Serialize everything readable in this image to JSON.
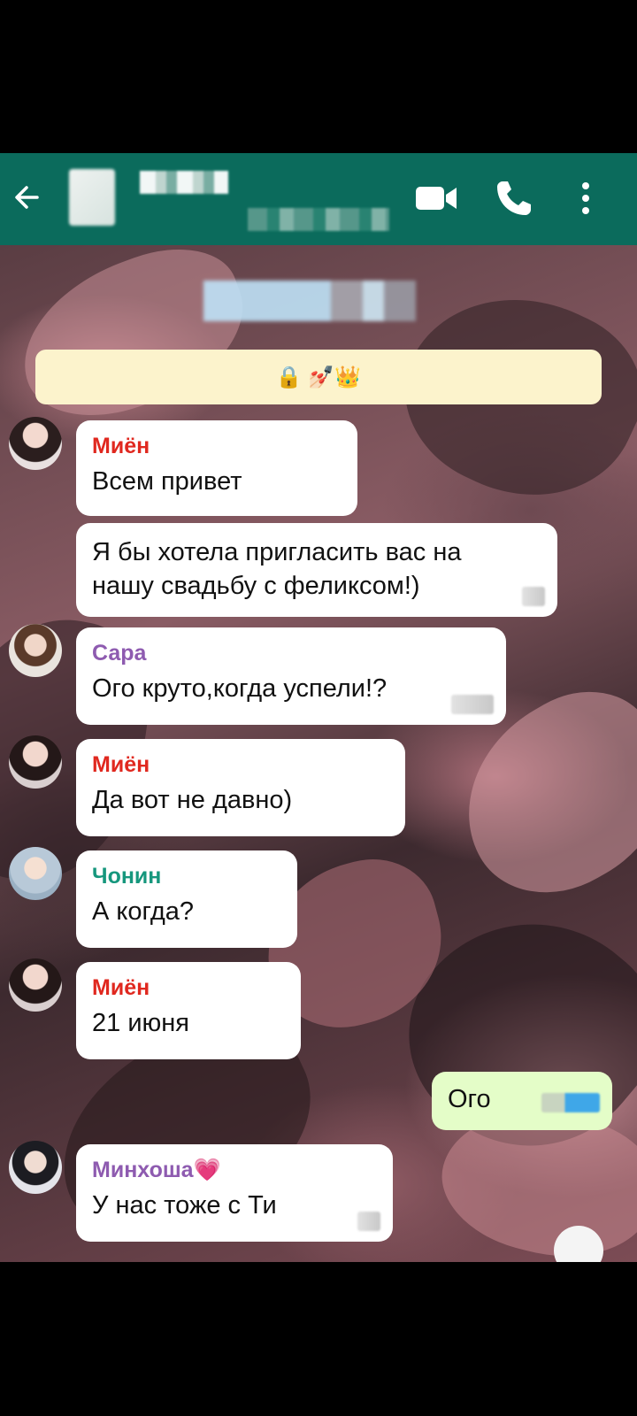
{
  "header": {
    "back_icon": "arrow-left-icon",
    "video_icon": "video-camera-icon",
    "call_icon": "phone-icon",
    "menu_icon": "more-vertical-icon",
    "bg_color": "#0b6b5c"
  },
  "system_message": {
    "text": "🔒 💅🏻👑"
  },
  "messages": [
    {
      "sender": "Миён",
      "sender_color": "#e0281f",
      "text": "Всем привет"
    },
    {
      "sender": "",
      "text": "Я бы хотела пригласить вас на\nнашу свадьбу с феликсом!)"
    },
    {
      "sender": "Сара",
      "sender_color": "#8e5bb0",
      "text": "Ого круто,когда успели!?"
    },
    {
      "sender": "Миён",
      "sender_color": "#e0281f",
      "text": "Да вот не давно)"
    },
    {
      "sender": "Чонин",
      "sender_color": "#16977d",
      "text": "А когда?"
    },
    {
      "sender": "Миён",
      "sender_color": "#e0281f",
      "text": "21 июня"
    },
    {
      "sender": "",
      "text": "Ого",
      "outgoing": true
    },
    {
      "sender": "Минхоша💗",
      "sender_color": "#8e5bb0",
      "text": "У нас тоже с Ти"
    }
  ]
}
